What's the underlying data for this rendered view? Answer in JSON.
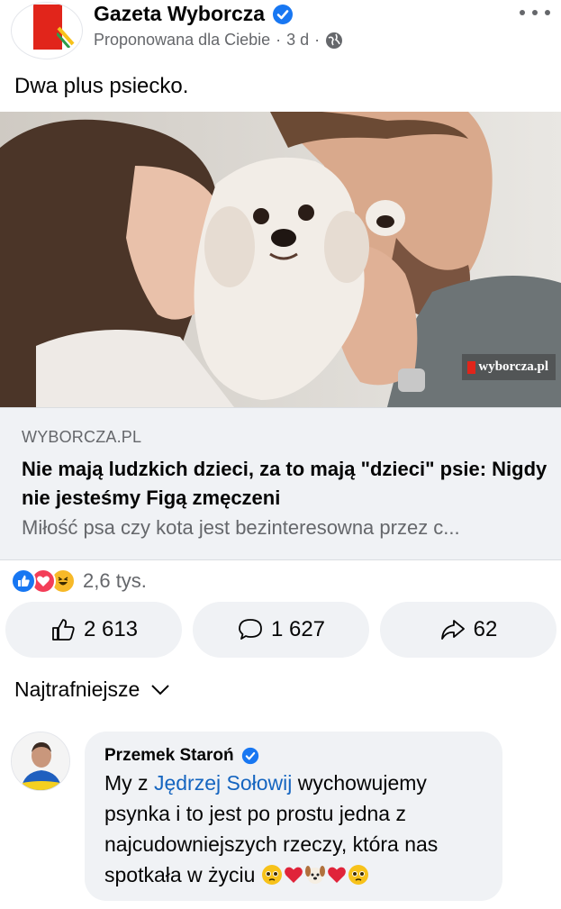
{
  "post": {
    "page_name": "Gazeta Wyborcza",
    "audience_text": "Proponowana dla Ciebie",
    "separator": "·",
    "time": "3 d",
    "text": "Dwa plus psiecko."
  },
  "link_preview": {
    "image_watermark": "wyborcza.pl",
    "domain": "WYBORCZA.PL",
    "title": "Nie mają ludzkich dzieci, za to mają \"dzieci\" psie: Nigdy nie jesteśmy Figą zmęczeni",
    "description": "Miłość psa czy kota jest bezinteresowna przez c..."
  },
  "reactions": {
    "types": [
      "like",
      "love",
      "haha"
    ],
    "count_text": "2,6 tys."
  },
  "actions": {
    "like_count": "2 613",
    "comment_count": "1 627",
    "share_count": "62"
  },
  "comments": {
    "sort_label": "Najtrafniejsze",
    "first": {
      "author": "Przemek Staroń",
      "text_before": "My z ",
      "mention": "Jędrzej Sołowij",
      "text_after": " wychowujemy psynka i to jest po prostu jedna z najcudowniejszych rzeczy, która nas spotkała w życiu ",
      "emojis": [
        "pleading-face",
        "red-heart",
        "dog-face",
        "red-heart",
        "pleading-face"
      ]
    }
  },
  "colors": {
    "brand_blue": "#1877f2",
    "gazeta_red": "#e1251b",
    "secondary_text": "#65676b",
    "bubble_bg": "#f0f2f5",
    "mention": "#1565c0"
  }
}
